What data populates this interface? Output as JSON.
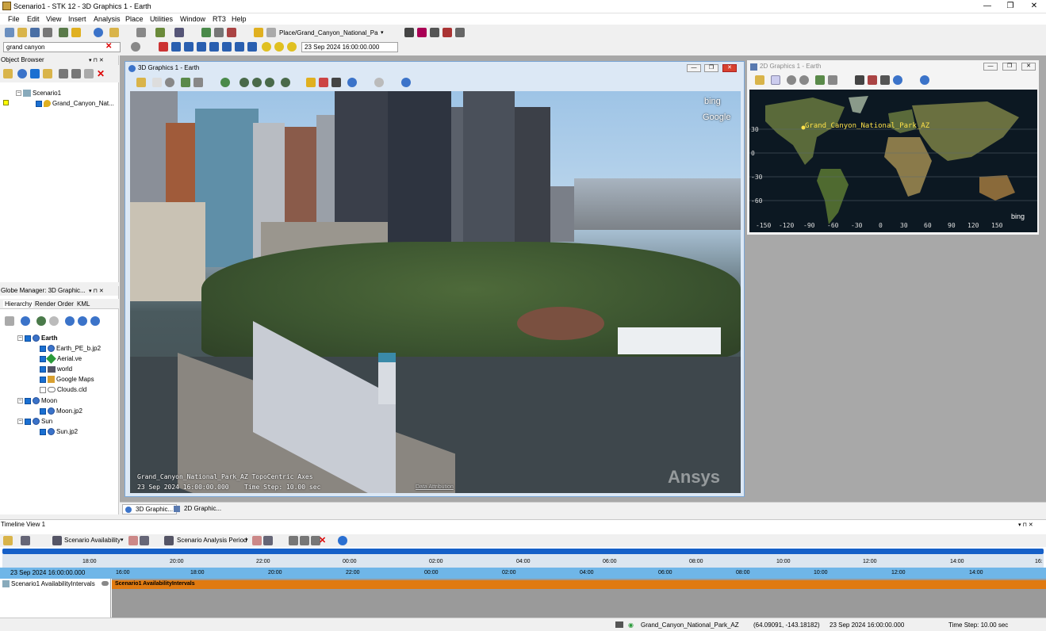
{
  "app": {
    "title": "Scenario1 - STK 12 - 3D Graphics 1 - Earth",
    "win_min": "—",
    "win_max": "❐",
    "win_close": "✕"
  },
  "menu": [
    "File",
    "Edit",
    "View",
    "Insert",
    "Analysis",
    "Place",
    "Utilities",
    "Window",
    "RT3",
    "Help"
  ],
  "toolbar": {
    "place_path": "Place/Grand_Canyon_National_Pa",
    "search_value": "grand canyon",
    "time_value": "23 Sep 2024 16:00:00.000"
  },
  "object_browser": {
    "title": "Object Browser",
    "scenario": "Scenario1",
    "child": "Grand_Canyon_Nat..."
  },
  "globe_manager": {
    "title": "Globe Manager: 3D Graphic...",
    "tabs": [
      "Hierarchy",
      "Render Order",
      "KML"
    ],
    "items": [
      {
        "label": "Earth",
        "bold": true
      },
      {
        "label": "Earth_PE_b.jp2"
      },
      {
        "label": "Aerial.ve"
      },
      {
        "label": "world"
      },
      {
        "label": "Google Maps"
      },
      {
        "label": "Clouds.cld"
      },
      {
        "label": "Moon"
      },
      {
        "label": "Moon.jp2"
      },
      {
        "label": "Sun"
      },
      {
        "label": "Sun.jp2"
      }
    ]
  },
  "graphics3d": {
    "title": "3D Graphics 1 - Earth",
    "overlay_line1": "Grand_Canyon_National_Park_AZ TopoCentric Axes",
    "overlay_line2": "23 Sep 2024 16:00:00.000",
    "overlay_step": "Time Step: 10.00 sec",
    "data_attribution": "Data Attribution",
    "bing": "bing",
    "google": "Google",
    "ansys": "Ansys"
  },
  "graphics2d": {
    "title": "2D Graphics 1 - Earth",
    "place_label": "Grand_Canyon_National_Park_AZ",
    "lat_ticks": [
      "30",
      "0",
      "-30",
      "-60"
    ],
    "lon_ticks": [
      "-150",
      "-120",
      "-90",
      "-60",
      "-30",
      "0",
      "30",
      "60",
      "90",
      "120",
      "150"
    ],
    "bing": "bing"
  },
  "doc_tabs": [
    "3D Graphic...",
    "2D Graphic..."
  ],
  "timeline": {
    "title": "Timeline View 1",
    "availability": "Scenario Availability",
    "analysis_period": "Scenario Analysis Period",
    "top_ticks": [
      "18:00",
      "20:00",
      "22:00",
      "00:00",
      "02:00",
      "04:00",
      "06:00",
      "08:00",
      "10:00",
      "12:00",
      "14:00",
      "16:"
    ],
    "start_time": "23 Sep 2024 16:00:00.000",
    "bottom_ticks": [
      "16:00",
      "18:00",
      "20:00",
      "22:00",
      "00:00",
      "02:00",
      "04:00",
      "06:00",
      "08:00",
      "10:00",
      "12:00",
      "14:00"
    ],
    "row_label": "Scenario1 AvailabilityIntervals",
    "bar_label": "Scenario1 AvailabilityIntervals"
  },
  "status": {
    "object": "Grand_Canyon_National_Park_AZ",
    "coords": "(64.09091, -143.18182)",
    "time": "23 Sep 2024 16:00:00.000",
    "step": "Time Step: 10.00 sec"
  },
  "colors": {
    "timeline_bar": "#e07a10",
    "time_strip": "#6fb6e8",
    "map_label": "#ffe24a"
  }
}
